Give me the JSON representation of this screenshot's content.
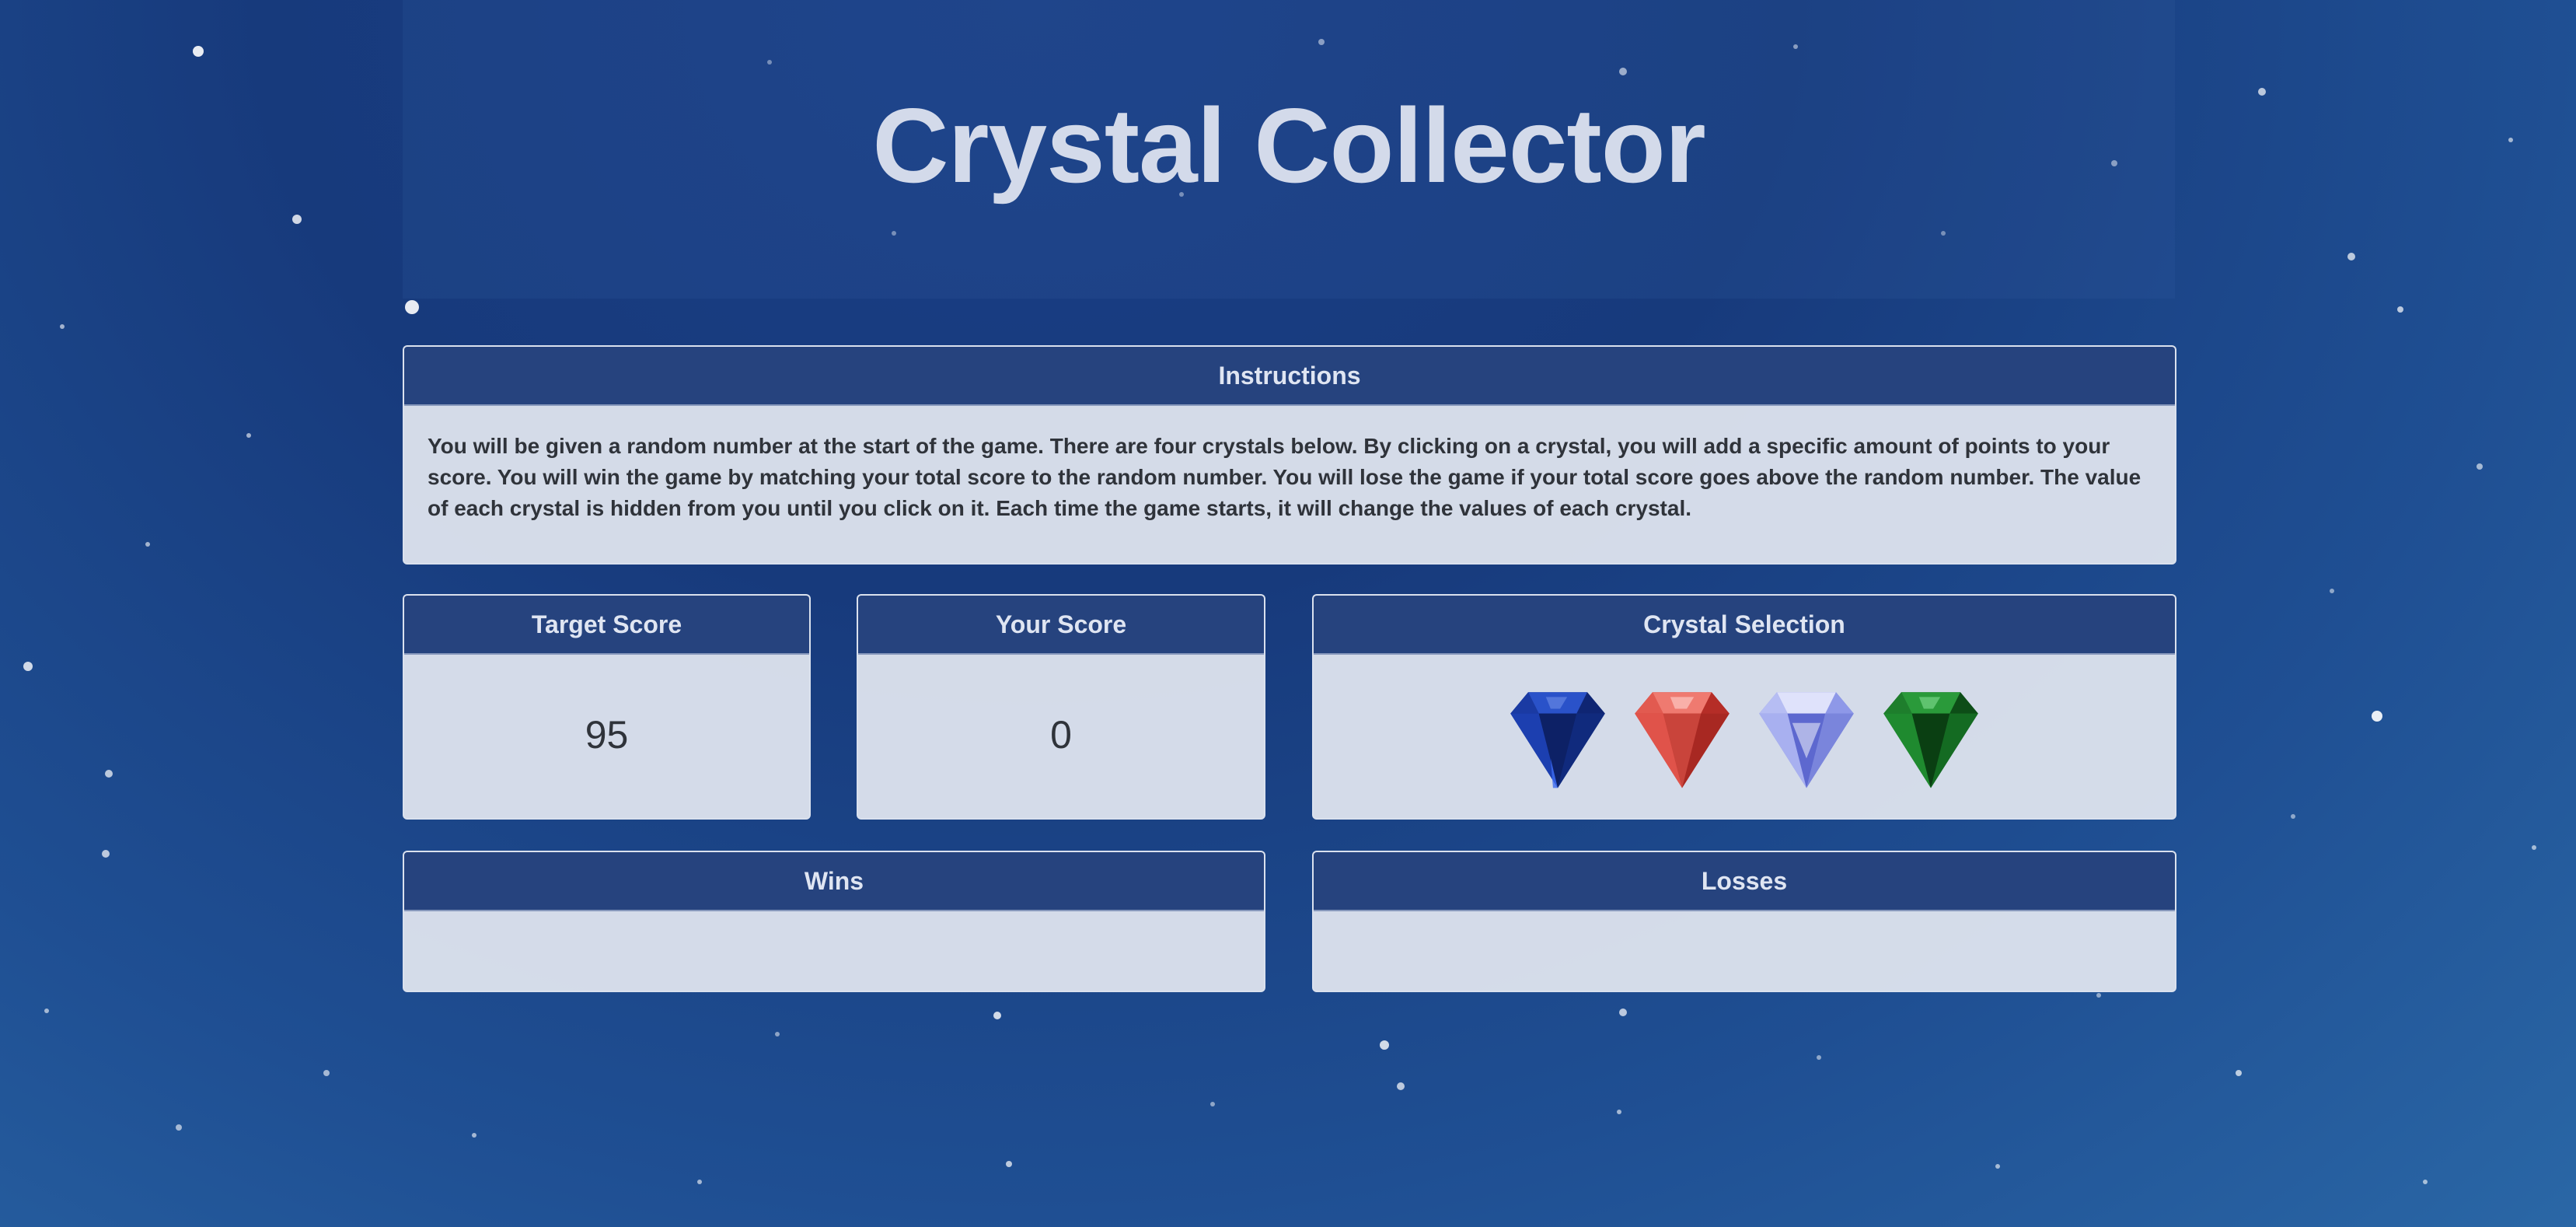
{
  "title": "Crystal Collector",
  "instructions": {
    "heading": "Instructions",
    "text": "You will be given a random number at the start of the game. There are four crystals below. By clicking on a crystal, you will add a specific amount of points to your score. You will win the game by matching your total score to the random number. You will lose the game if your total score goes above the random number. The value of each crystal is hidden from you until you click on it. Each time the game starts, it will change the values of each crystal."
  },
  "target": {
    "heading": "Target Score",
    "value": "95"
  },
  "score": {
    "heading": "Your Score",
    "value": "0"
  },
  "crystal_selection": {
    "heading": "Crystal Selection",
    "crystals": [
      {
        "name": "blue-crystal-icon",
        "color": "#1d3fae"
      },
      {
        "name": "red-crystal-icon",
        "color": "#d8473d"
      },
      {
        "name": "lavender-crystal-icon",
        "color": "#8d97e6"
      },
      {
        "name": "green-crystal-icon",
        "color": "#1f8a2f"
      }
    ]
  },
  "wins": {
    "heading": "Wins"
  },
  "losses": {
    "heading": "Losses"
  }
}
